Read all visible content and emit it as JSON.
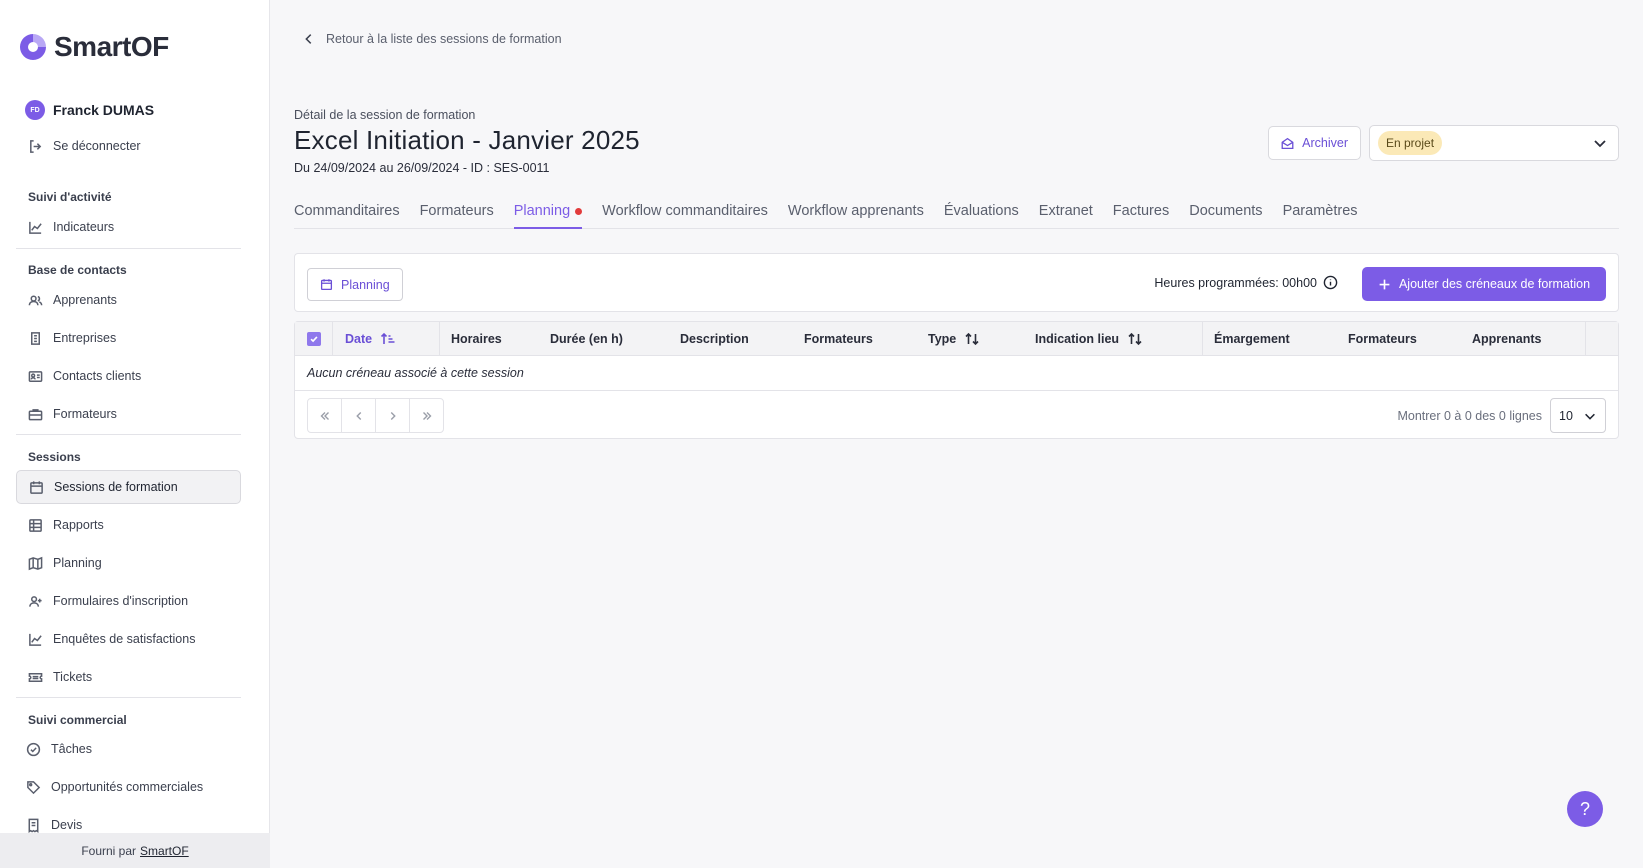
{
  "app": {
    "logo_text": "SmartOF",
    "footer_prefix": "Fourni par",
    "footer_link": "SmartOF",
    "brand_color": "#7c5ce6"
  },
  "user": {
    "initials": "FD",
    "name": "Franck DUMAS",
    "logout_label": "Se déconnecter"
  },
  "sidebar": {
    "sections": {
      "activity": "Suivi d'activité",
      "contacts": "Base de contacts",
      "sessions": "Sessions",
      "commercial": "Suivi commercial"
    },
    "items": {
      "indicators": "Indicateurs",
      "learners": "Apprenants",
      "companies": "Entreprises",
      "client_contacts": "Contacts clients",
      "trainers": "Formateurs",
      "training_sessions": "Sessions de formation",
      "reports": "Rapports",
      "planning": "Planning",
      "registration_forms": "Formulaires d'inscription",
      "satisfaction_surveys": "Enquêtes de satisfactions",
      "tickets": "Tickets",
      "tasks": "Tâches",
      "opportunities": "Opportunités commerciales",
      "quotes": "Devis"
    }
  },
  "header": {
    "back_label": "Retour à la liste des sessions de formation",
    "subtitle": "Détail de la session de formation",
    "title": "Excel Initiation - Janvier 2025",
    "dates": "Du 24/09/2024 au 26/09/2024 - ID : SES-0011",
    "archive_label": "Archiver",
    "status": "En projet"
  },
  "tabs": [
    "Commanditaires",
    "Formateurs",
    "Planning",
    "Workflow commanditaires",
    "Workflow apprenants",
    "Évaluations",
    "Extranet",
    "Factures",
    "Documents",
    "Paramètres"
  ],
  "toolbar": {
    "planning_label": "Planning",
    "hours_label": "Heures programmées: 00h00",
    "add_label": "Ajouter des créneaux de formation"
  },
  "table": {
    "columns": {
      "date": "Date",
      "hours": "Horaires",
      "duration": "Durée (en h)",
      "description": "Description",
      "trainers": "Formateurs",
      "type": "Type",
      "location": "Indication lieu",
      "attendance": "Émargement",
      "trainers2": "Formateurs",
      "learners": "Apprenants"
    },
    "empty_message": "Aucun créneau associé à cette session",
    "rows_info": "Montrer 0 à 0 des 0 lignes",
    "page_size": "10"
  },
  "help": "?"
}
